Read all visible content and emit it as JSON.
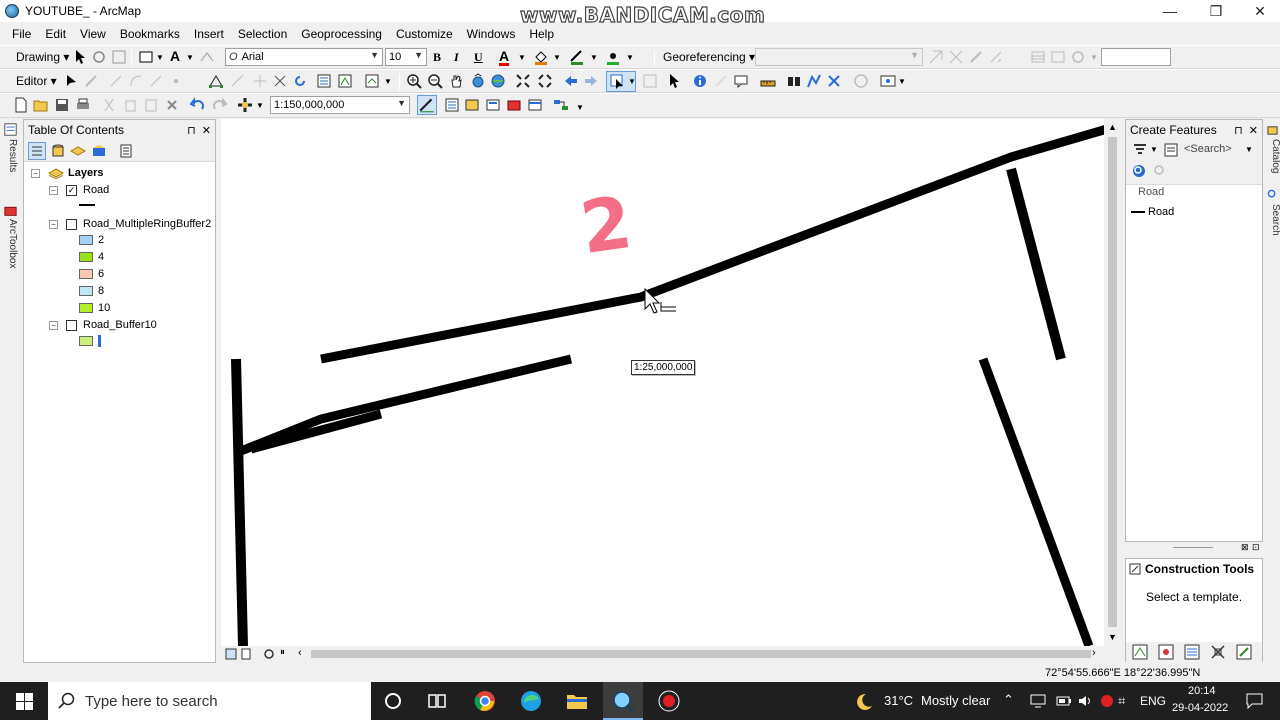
{
  "window": {
    "title": "YOUTUBE_ - ArcMap",
    "watermark": "www.BANDICAM.com",
    "min": "—",
    "max": "❐",
    "close": "✕"
  },
  "menu": [
    "File",
    "Edit",
    "View",
    "Bookmarks",
    "Insert",
    "Selection",
    "Geoprocessing",
    "Customize",
    "Windows",
    "Help"
  ],
  "draw_toolbar": {
    "drawing_label": "Drawing ▾",
    "font_name": "Arial",
    "font_size": "10",
    "bold": "B",
    "italic": "I",
    "underline": "U",
    "font_color": "A",
    "georef_label": "Georeferencing ▾"
  },
  "editor_toolbar": {
    "editor_label": "Editor ▾"
  },
  "standard_toolbar": {
    "scale": "1:150,000,000"
  },
  "toc": {
    "title": "Table Of Contents",
    "root": "Layers",
    "layers": [
      {
        "name": "Road",
        "checked": true
      },
      {
        "name": "Road_MultipleRingBuffer2",
        "checked": false,
        "classes": [
          {
            "label": "2",
            "color": "#a9d3f5"
          },
          {
            "label": "4",
            "color": "#9be01a"
          },
          {
            "label": "6",
            "color": "#f5c9b0"
          },
          {
            "label": "8",
            "color": "#bfe9f2"
          },
          {
            "label": "10",
            "color": "#b6ef2a"
          }
        ]
      },
      {
        "name": "Road_Buffer10",
        "checked": false,
        "swatch": "#cdf07a"
      }
    ],
    "check_mark": "✓"
  },
  "side_tabs": {
    "left": [
      "Results",
      "ArcToolbox"
    ],
    "right": [
      "Catalog",
      "Search"
    ]
  },
  "map": {
    "label": "2",
    "scale_tip": "1:25,000,000"
  },
  "create_features": {
    "title": "Create Features",
    "search_placeholder": "<Search>",
    "group": "Road",
    "template": "Road"
  },
  "construction_tools": {
    "title": "Construction Tools",
    "hint": "Select a template."
  },
  "status": {
    "coords": "72°54'55.666\"E  18°22'36.995\"N"
  },
  "taskbar": {
    "search": "Type here to search",
    "temp": "31°C",
    "weather": "Mostly clear",
    "lang": "ENG",
    "time": "20:14",
    "date": "29-04-2022"
  }
}
